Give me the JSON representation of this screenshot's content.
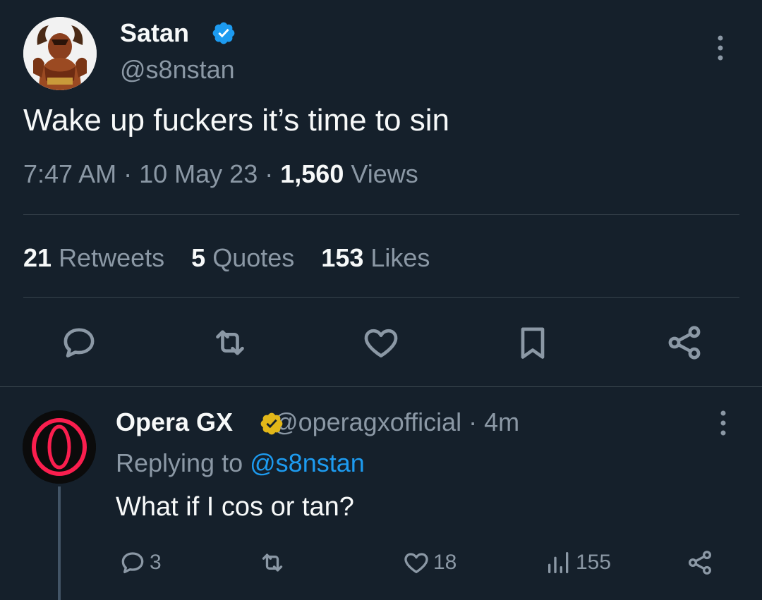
{
  "tweet": {
    "author_name": "Satan",
    "author_handle": "@s8nstan",
    "text": "Wake up fuckers it’s time to sin",
    "time": "7:47 AM",
    "sep1": "·",
    "date": "10 May 23",
    "sep2": "·",
    "views_count": "1,560",
    "views_label": "Views",
    "stats": {
      "retweets_count": "21",
      "retweets_label": "Retweets",
      "quotes_count": "5",
      "quotes_label": "Quotes",
      "likes_count": "153",
      "likes_label": "Likes"
    },
    "actions": [
      "reply-icon",
      "retweet-icon",
      "like-icon",
      "bookmark-icon",
      "share-icon"
    ]
  },
  "reply": {
    "author_name": "Opera GX",
    "author_handle": "@operagxofficial",
    "sep": "·",
    "time": "4m",
    "replying_label": "Replying to",
    "replying_to": "@s8nstan",
    "text": "What if I cos or tan?",
    "reply_count": "3",
    "like_count": "18",
    "views_count": "155"
  },
  "colors": {
    "background": "#15202b",
    "text": "#f7f9f9",
    "muted": "#8b98a5",
    "accent": "#1d9bf0",
    "verified_blue": "#1d9bf0",
    "verified_gold": "#e2b719",
    "divider": "#38444d"
  }
}
